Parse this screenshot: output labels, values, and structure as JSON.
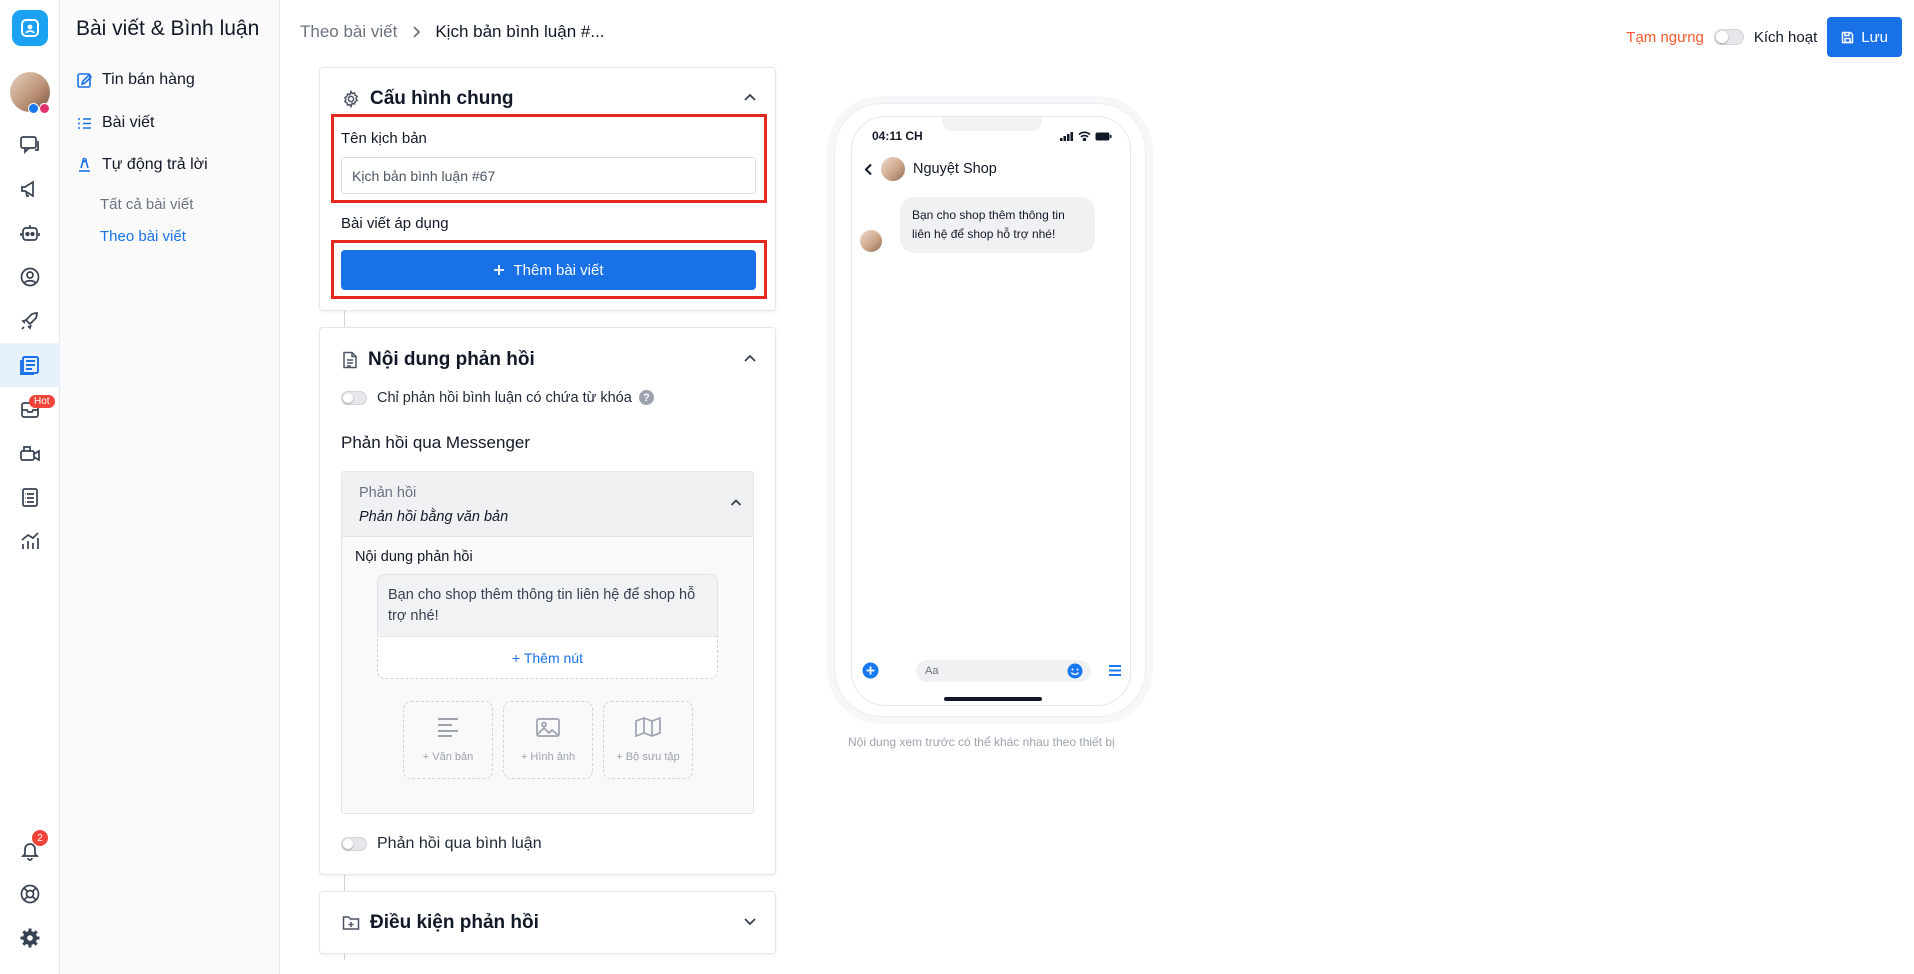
{
  "sidebar": {
    "title": "Bài viết & Bình luận",
    "items": [
      {
        "label": "Tin bán hàng",
        "icon": "edit-note-icon"
      },
      {
        "label": "Bài viết",
        "icon": "list-icon"
      },
      {
        "label": "Tự động trả lời",
        "icon": "auto-reply-icon"
      }
    ],
    "subitems": [
      {
        "label": "Tất cả bài viết"
      },
      {
        "label": "Theo bài viết"
      }
    ]
  },
  "rail": {
    "hot_badge": "Hot",
    "notification_count": "2"
  },
  "breadcrumb": {
    "parent": "Theo bài viết",
    "current": "Kịch bản bình luận #..."
  },
  "header": {
    "pause_label": "Tạm ngưng",
    "activate_label": "Kích hoạt",
    "save_label": "Lưu"
  },
  "general": {
    "title": "Cấu hình chung",
    "name_label": "Tên kịch bản",
    "name_value": "Kịch bản bình luận #67",
    "posts_label": "Bài viết áp dụng",
    "add_post_label": "Thêm bài viết"
  },
  "reply": {
    "title": "Nội dung phản hồi",
    "keyword_toggle_label": "Chỉ phản hồi bình luận có chứa từ khóa",
    "messenger_heading": "Phản hồi qua Messenger",
    "reply_type_label": "Phản hồi",
    "reply_type_value": "Phản hồi bằng văn bản",
    "content_label": "Nội dung phản hồi",
    "content_text": "Bạn cho shop thêm thông tin liên hệ để shop hỗ trợ nhé!",
    "add_button_label": "+ Thêm nút",
    "tiles": [
      {
        "label": "+ Văn bản",
        "icon": "text-lines-icon"
      },
      {
        "label": "+ Hình ảnh",
        "icon": "image-icon"
      },
      {
        "label": "+ Bộ sưu tập",
        "icon": "map-gallery-icon"
      }
    ],
    "comment_toggle_label": "Phản hồi qua bình luận"
  },
  "conditions": {
    "title": "Điều kiện phản hồi"
  },
  "preview": {
    "time": "04:11 CH",
    "shop_name": "Nguyệt Shop",
    "message": "Bạn cho shop thêm thông tin liên hệ để shop hỗ trợ nhé!",
    "composer_placeholder": "Aa",
    "note": "Nội dung xem trước có thể khác nhau theo thiết bị"
  },
  "colors": {
    "accent": "#1971e8",
    "pause": "#f15a2b",
    "highlight": "#e5291f"
  }
}
